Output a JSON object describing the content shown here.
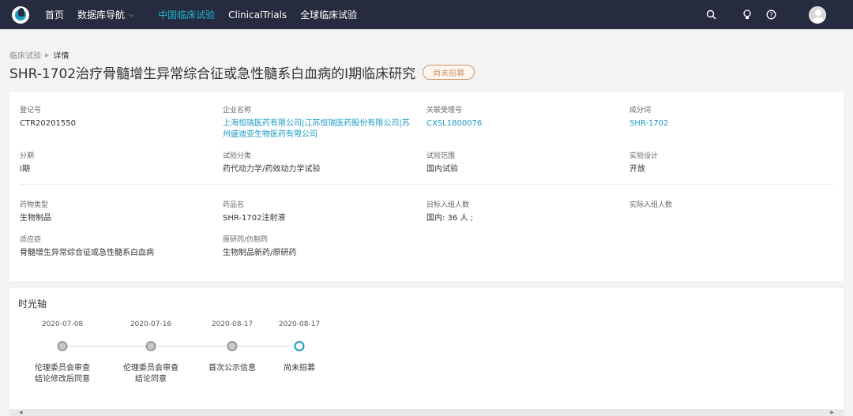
{
  "nav": {
    "items": [
      {
        "label": "首页"
      },
      {
        "label": "数据库导航"
      },
      {
        "label": "中国临床试验"
      },
      {
        "label": "ClinicalTrials"
      },
      {
        "label": "全球临床试验"
      }
    ]
  },
  "breadcrumb": {
    "parent": "临床试验",
    "current": "详情"
  },
  "title": "SHR-1702治疗骨髓增生异常综合征或急性髓系白血病的I期临床研究",
  "status_tag": "尚未招募",
  "fields": {
    "reg_no": {
      "label": "登记号",
      "value": "CTR20201550"
    },
    "company": {
      "label": "企业名称",
      "value": "上海恒瑞医药有限公司|江苏恒瑞医药股份有限公司|苏州盛迪亚生物医药有限公司"
    },
    "accept_no": {
      "label": "关联受理号",
      "value": "CXSL1800076"
    },
    "ingredient": {
      "label": "成分词",
      "value": "SHR-1702"
    },
    "phase": {
      "label": "分期",
      "value": "I期"
    },
    "category": {
      "label": "试验分类",
      "value": "药代动力学/药效动力学试验"
    },
    "scope": {
      "label": "试验范围",
      "value": "国内试验"
    },
    "design": {
      "label": "实验设计",
      "value": "开放"
    },
    "drug_type": {
      "label": "药物类型",
      "value": "生物制品"
    },
    "drug_name": {
      "label": "药品名",
      "value": "SHR-1702注射液"
    },
    "target_n": {
      "label": "目标入组人数",
      "value": "国内: 36 人 ;"
    },
    "actual_n": {
      "label": "实际入组人数",
      "value": ""
    },
    "indication": {
      "label": "适应症",
      "value": "骨髓增生异常综合征或急性髓系白血病"
    },
    "origin": {
      "label": "原研药/仿制药",
      "value": "生物制品新药/原研药"
    }
  },
  "timeline": {
    "title": "时光轴",
    "events": [
      {
        "date": "2020-07-08",
        "label_l1": "伦理委员会审查",
        "label_l2": "结论修改后同意"
      },
      {
        "date": "2020-07-16",
        "label_l1": "伦理委员会审查",
        "label_l2": "结论同意"
      },
      {
        "date": "2020-08-17",
        "label_l1": "首次公示信息",
        "label_l2": ""
      },
      {
        "date": "2020-08-17",
        "label_l1": "尚未招募",
        "label_l2": ""
      }
    ]
  },
  "colors": {
    "accent": "#1a9ac4",
    "topbar": "#262b3f",
    "status": "#c9956a"
  }
}
